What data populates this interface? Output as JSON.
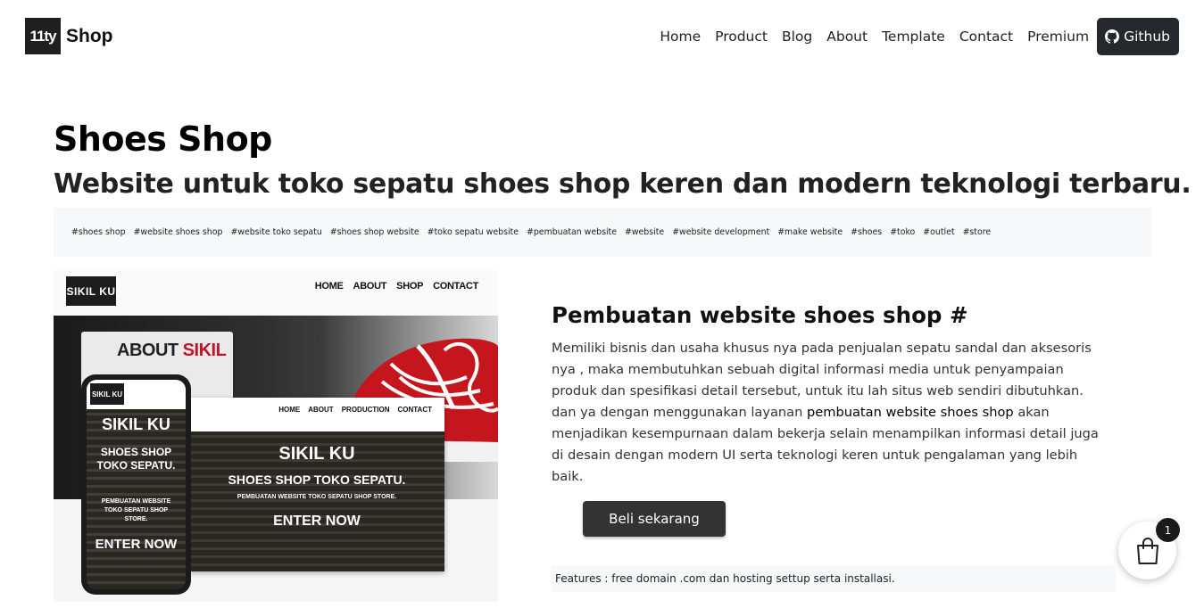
{
  "header": {
    "logo_mark": "11ty",
    "logo_text": "Shop",
    "nav": [
      "Home",
      "Product",
      "Blog",
      "About",
      "Template",
      "Contact",
      "Premium"
    ],
    "github_label": "Github"
  },
  "hero": {
    "title": "Shoes Shop",
    "subtitle": "Website untuk toko sepatu shoes shop keren dan modern teknologi terbaru."
  },
  "tags": [
    "#shoes shop",
    "#website shoes shop",
    "#website toko sepatu",
    "#shoes shop website",
    "#toko sepatu website",
    "#pembuatan website",
    "#website",
    "#website development",
    "#make website",
    "#shoes",
    "#toko",
    "#outlet",
    "#store"
  ],
  "mockup": {
    "logo": "SIKIL KU",
    "nav": [
      "HOME",
      "ABOUT",
      "SHOP",
      "CONTACT"
    ],
    "about_a": "ABOUT",
    "about_b": "SIKIL",
    "laptop_nav": [
      "HOME",
      "ABOUT",
      "PRODUCTION",
      "CONTACT"
    ],
    "hero_line1": "SIKIL KU",
    "hero_line2": "SHOES SHOP TOKO SEPATU.",
    "hero_line3": "PEMBUATAN WEBSITE TOKO SEPATU SHOP STORE.",
    "hero_cta": "ENTER NOW",
    "phone_logo": "SIKIL KU",
    "phone_line1": "SIKIL KU",
    "phone_line2": "SHOES SHOP TOKO SEPATU.",
    "phone_line3": "PEMBUATAN WEBSITE TOKO SEPATU SHOP STORE.",
    "phone_cta": "ENTER NOW"
  },
  "content": {
    "title": "Pembuatan website shoes shop #",
    "body_before": "Memiliki bisnis dan usaha khusus nya pada penjualan sepatu sandal dan aksesoris nya , maka membutuhkan sebuah digital informasi media untuk penyampaian produk dan spesifikasi detail tersebut, untuk itu lah situs web sendiri dibutuhkan. dan ya dengan menggunakan layanan ",
    "body_highlight": "pembuatan website shoes shop",
    "body_after": " akan menjadikan kesempurnaan dalam bekerja selain menampilkan informasi detail juga di desain dengan modern UI serta teknologi keren untuk pengalaman yang lebih baik.",
    "buy_label": "Beli sekarang",
    "features": "Features : free domain .com dan hosting settup serta installasi."
  },
  "cart": {
    "count": "1",
    "icon": "shopping-bag-icon"
  }
}
